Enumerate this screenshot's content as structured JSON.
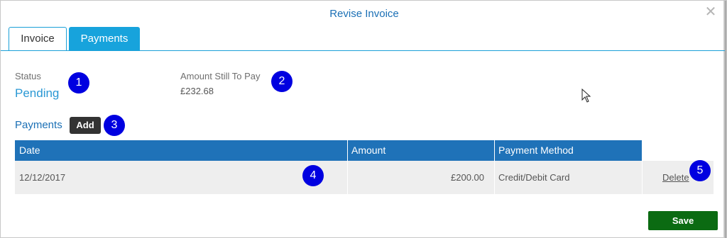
{
  "dialog": {
    "title": "Revise Invoice",
    "close_glyph": "✕"
  },
  "tabs": [
    {
      "label": "Invoice",
      "active": false
    },
    {
      "label": "Payments",
      "active": true
    }
  ],
  "status": {
    "label": "Status",
    "value": "Pending"
  },
  "amount_due": {
    "label": "Amount Still To Pay",
    "value": "£232.68"
  },
  "payments": {
    "section_label": "Payments",
    "add_label": "Add",
    "columns": [
      "Date",
      "Amount",
      "Payment Method"
    ],
    "rows": [
      {
        "date": "12/12/2017",
        "amount": "£200.00",
        "method": "Credit/Debit Card",
        "action": "Delete"
      }
    ]
  },
  "badges": [
    "1",
    "2",
    "3",
    "4",
    "5"
  ],
  "footer": {
    "save_label": "Save"
  },
  "colors": {
    "title": "#1a6fb5",
    "tab_active": "#17a3dc",
    "table_header": "#1f72b8",
    "badge": "#0000e0",
    "save": "#0b6b12"
  }
}
